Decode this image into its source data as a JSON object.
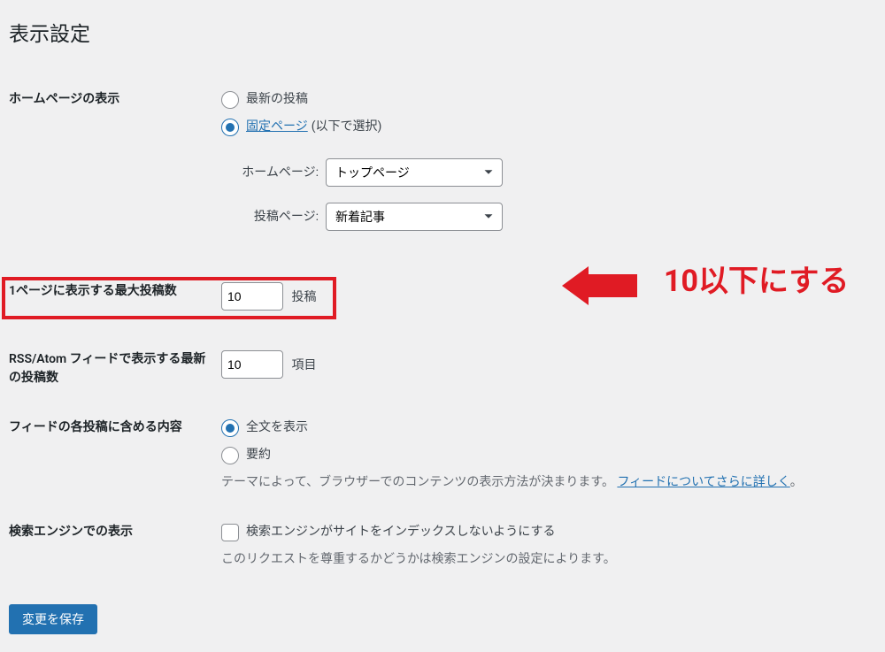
{
  "page": {
    "title": "表示設定"
  },
  "homepage": {
    "label": "ホームページの表示",
    "option_latest": "最新の投稿",
    "option_static_link": "固定ページ",
    "option_static_note": "(以下で選択)",
    "homepage_label": "ホームページ:",
    "homepage_select": "トップページ",
    "posts_page_label": "投稿ページ:",
    "posts_page_select": "新着記事"
  },
  "posts_per_page": {
    "label": "1ページに表示する最大投稿数",
    "value": "10",
    "suffix": "投稿",
    "annotation": "10以下にする"
  },
  "feed_items": {
    "label": "RSS/Atom フィードで表示する最新の投稿数",
    "value": "10",
    "suffix": "項目"
  },
  "feed_content": {
    "label": "フィードの各投稿に含める内容",
    "option_full": "全文を表示",
    "option_summary": "要約",
    "description_pre": "テーマによって、ブラウザーでのコンテンツの表示方法が決まります。",
    "description_link": "フィードについてさらに詳しく",
    "description_post": "。"
  },
  "search_engine": {
    "label": "検索エンジンでの表示",
    "checkbox_label": "検索エンジンがサイトをインデックスしないようにする",
    "description": "このリクエストを尊重するかどうかは検索エンジンの設定によります。"
  },
  "save_button": "変更を保存"
}
